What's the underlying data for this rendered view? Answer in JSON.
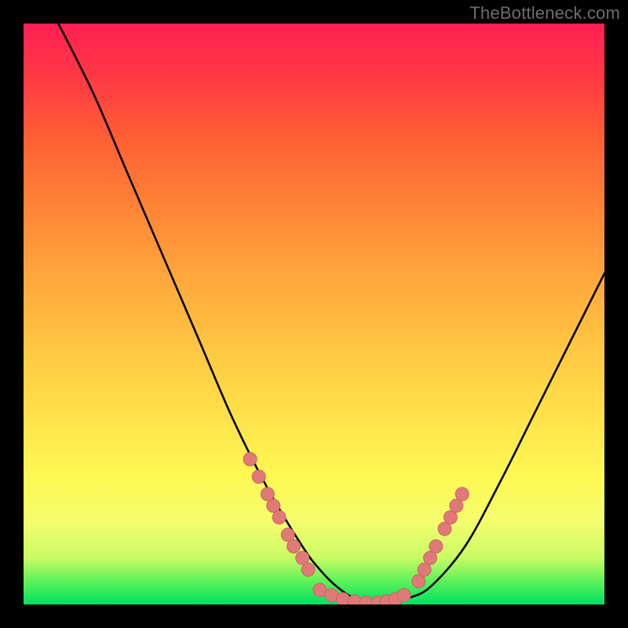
{
  "attribution": "TheBottleneck.com",
  "colors": {
    "background": "#000000",
    "curve": "#000000",
    "marker_fill": "#e07a78",
    "marker_stroke": "#c96560",
    "gradient_stops": [
      "#00e060",
      "#5df25a",
      "#c9fb63",
      "#f3fd6e",
      "#fef953",
      "#ffe24a",
      "#ffc742",
      "#ffa83c",
      "#ff8537",
      "#ff6034",
      "#ff3b42",
      "#ff1f55"
    ]
  },
  "chart_data": {
    "type": "line",
    "title": "",
    "xlabel": "",
    "ylabel": "",
    "xlim": [
      0,
      100
    ],
    "ylim": [
      0,
      100
    ],
    "grid": false,
    "legend": false,
    "series": [
      {
        "name": "curve",
        "x": [
          6,
          12,
          18,
          24,
          30,
          36,
          42,
          48,
          51,
          54,
          57,
          60,
          63,
          66,
          70,
          76,
          82,
          88,
          94,
          100
        ],
        "values": [
          100,
          88,
          74,
          60,
          46,
          32,
          20,
          10,
          6,
          3,
          1,
          0,
          0,
          1,
          3,
          10,
          21,
          33,
          45,
          57
        ]
      }
    ],
    "markers_left": {
      "x": [
        39,
        40.5,
        42,
        43,
        44,
        45.5,
        46.5,
        48,
        49
      ],
      "values": [
        25,
        22,
        19,
        17,
        15,
        12,
        10,
        8,
        6
      ]
    },
    "markers_bottom": {
      "x": [
        51,
        53,
        55,
        57,
        59,
        61,
        62.5,
        64,
        65.5
      ],
      "values": [
        2.5,
        1.6,
        0.9,
        0.5,
        0.3,
        0.3,
        0.5,
        0.9,
        1.6
      ]
    },
    "markers_right": {
      "x": [
        68,
        69,
        70,
        71,
        72.5,
        73.5,
        74.5,
        75.5
      ],
      "values": [
        4,
        6,
        8,
        10,
        13,
        15,
        17,
        19
      ]
    }
  }
}
